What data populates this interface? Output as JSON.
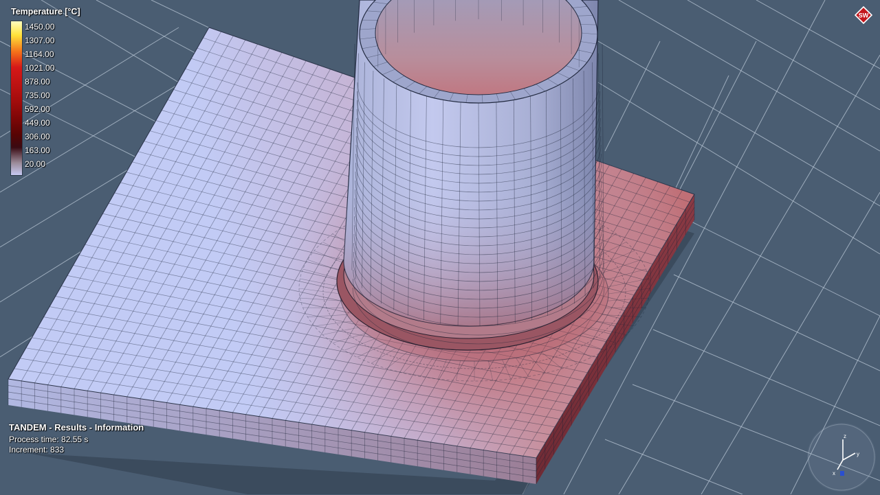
{
  "legend": {
    "title": "Temperature [°C]",
    "values": [
      "1450.00",
      "1307.00",
      "1164.00",
      "1021.00",
      "878.00",
      "735.00",
      "592.00",
      "449.00",
      "306.00",
      "163.00",
      "20.00"
    ]
  },
  "info": {
    "title": "TANDEM - Results - Information",
    "process_time": "Process time: 82.55 s",
    "increment": "Increment: 833"
  },
  "logo": {
    "text": "SW",
    "color": "#c4161c"
  },
  "triad": {
    "x": "x",
    "y": "y",
    "z": "z"
  },
  "colors": {
    "background": "#4a5d72",
    "grid": "#b9c7d6",
    "cold": "#c4cbf4",
    "hot": "#bd6a72",
    "mesh": "#1b2438"
  }
}
